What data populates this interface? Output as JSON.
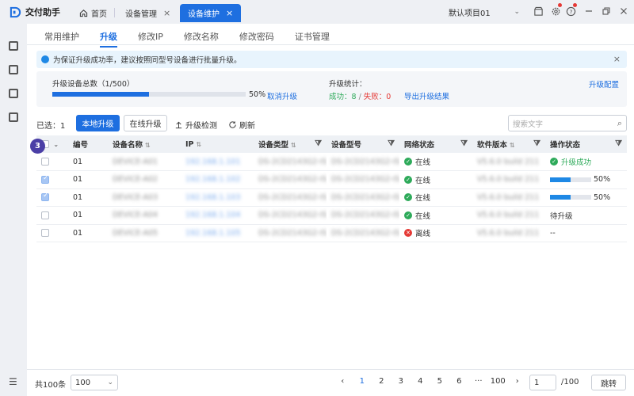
{
  "app": {
    "title": "交付助手"
  },
  "tabs": [
    {
      "label": "首页",
      "icon": "home-icon"
    },
    {
      "label": "设备管理",
      "close": "×"
    },
    {
      "label": "设备维护",
      "close": "×",
      "active": true
    }
  ],
  "project": {
    "selected": "默认项目01"
  },
  "window_icons": [
    "store-icon",
    "settings-icon",
    "help-icon",
    "minimize-icon",
    "restore-icon",
    "close-icon"
  ],
  "subtabs": [
    "常用维护",
    "升级",
    "修改IP",
    "修改名称",
    "修改密码",
    "证书管理"
  ],
  "active_subtab": "升级",
  "notice": {
    "text": "为保证升级成功率，建议按照同型号设备进行批量升级。",
    "close": "×"
  },
  "summary": {
    "total_label": "升级设备总数（1/500）",
    "progress": 0.5,
    "progress_text": "50%",
    "cancel_label": "取消升级",
    "stats_label": "升级统计：",
    "success_text": "成功：8",
    "sep": " / ",
    "fail_text": "失败：0",
    "export_label": "导出升级结果",
    "config_label": "升级配置"
  },
  "toolbar": {
    "selected_text": "已选：1",
    "local_upgrade": "本地升级",
    "online_upgrade": "在线升级",
    "check_label": "升级检测",
    "refresh_label": "刷新",
    "search_placeholder": "搜索文字"
  },
  "table": {
    "headers": [
      "编号",
      "设备名称",
      "IP",
      "设备类型",
      "设备型号",
      "网络状态",
      "软件版本",
      "操作状态"
    ],
    "rows": [
      {
        "checked": false,
        "id": "01",
        "name": "DEVICE-A01",
        "ip": "192.168.1.101",
        "type": "DS-2CD2143G2-IS",
        "model": "DS-2CD2143G2-IS",
        "net": "在线",
        "net_ok": true,
        "version": "V5.6.0 build 211",
        "op": "升级成功",
        "op_kind": "success"
      },
      {
        "checked": true,
        "id": "01",
        "name": "DEVICE-A02",
        "ip": "192.168.1.102",
        "type": "DS-2CD2143G2-IS",
        "model": "DS-2CD2143G2-IS",
        "net": "在线",
        "net_ok": true,
        "version": "V5.6.0 build 211",
        "op": "50%",
        "op_kind": "progress",
        "op_progress": 0.5
      },
      {
        "checked": true,
        "id": "01",
        "name": "DEVICE-A03",
        "ip": "192.168.1.103",
        "type": "DS-2CD2143G2-IS",
        "model": "DS-2CD2143G2-IS",
        "net": "在线",
        "net_ok": true,
        "version": "V5.6.0 build 211",
        "op": "50%",
        "op_kind": "progress",
        "op_progress": 0.5
      },
      {
        "checked": false,
        "id": "01",
        "name": "DEVICE-A04",
        "ip": "192.168.1.104",
        "type": "DS-2CD2143G2-IS",
        "model": "DS-2CD2143G2-IS",
        "net": "在线",
        "net_ok": true,
        "version": "V5.6.0 build 211",
        "op": "待升级",
        "op_kind": "text"
      },
      {
        "checked": false,
        "id": "01",
        "name": "DEVICE-A05",
        "ip": "192.168.1.105",
        "type": "DS-2CD2143G2-IS",
        "model": "DS-2CD2143G2-IS",
        "net": "离线",
        "net_ok": false,
        "version": "V5.6.0 build 211",
        "op": "--",
        "op_kind": "text"
      }
    ]
  },
  "badge": {
    "text": "3"
  },
  "pagination": {
    "total_text": "共100条",
    "page_size": "100",
    "pages": [
      "1",
      "2",
      "3",
      "4",
      "5",
      "6",
      "···",
      "100"
    ],
    "current": "1",
    "goto_value": "1",
    "goto_total": "/100",
    "goto_button": "跳转"
  },
  "colors": {
    "accent": "#1e6fe0",
    "success": "#2eaa5a",
    "danger": "#e53935",
    "badge": "#4b3fa6"
  }
}
